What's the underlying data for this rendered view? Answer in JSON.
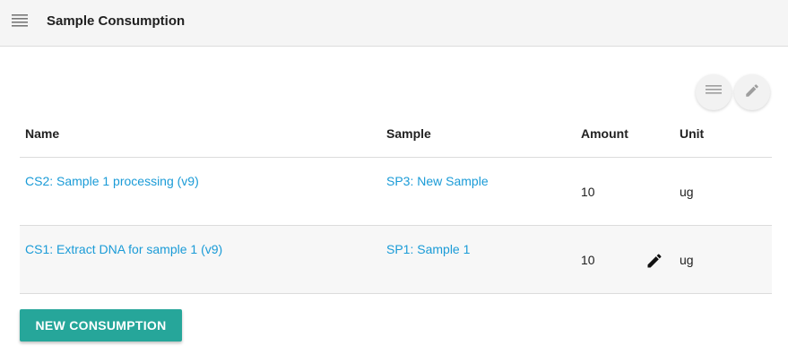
{
  "header": {
    "title": "Sample Consumption",
    "menu_icon": "hamburger-menu-icon"
  },
  "toolbar": {
    "list_icon": "list-view-icon",
    "edit_icon": "pencil-icon"
  },
  "table": {
    "columns": [
      "Name",
      "Sample",
      "Amount",
      "Unit"
    ],
    "rows": [
      {
        "name": "CS2: Sample 1 processing (v9)",
        "sample": "SP3: New Sample",
        "amount": "10",
        "unit": "ug"
      },
      {
        "name": "CS1: Extract DNA for sample 1 (v9)",
        "sample": "SP1: Sample 1",
        "amount": "10",
        "unit": "ug",
        "edit_icon": "pencil-icon"
      }
    ]
  },
  "actions": {
    "new_consumption_label": "NEW CONSUMPTION"
  },
  "colors": {
    "link": "#1a9bd7",
    "button": "#26a69a",
    "header_bg": "#f5f5f5"
  }
}
